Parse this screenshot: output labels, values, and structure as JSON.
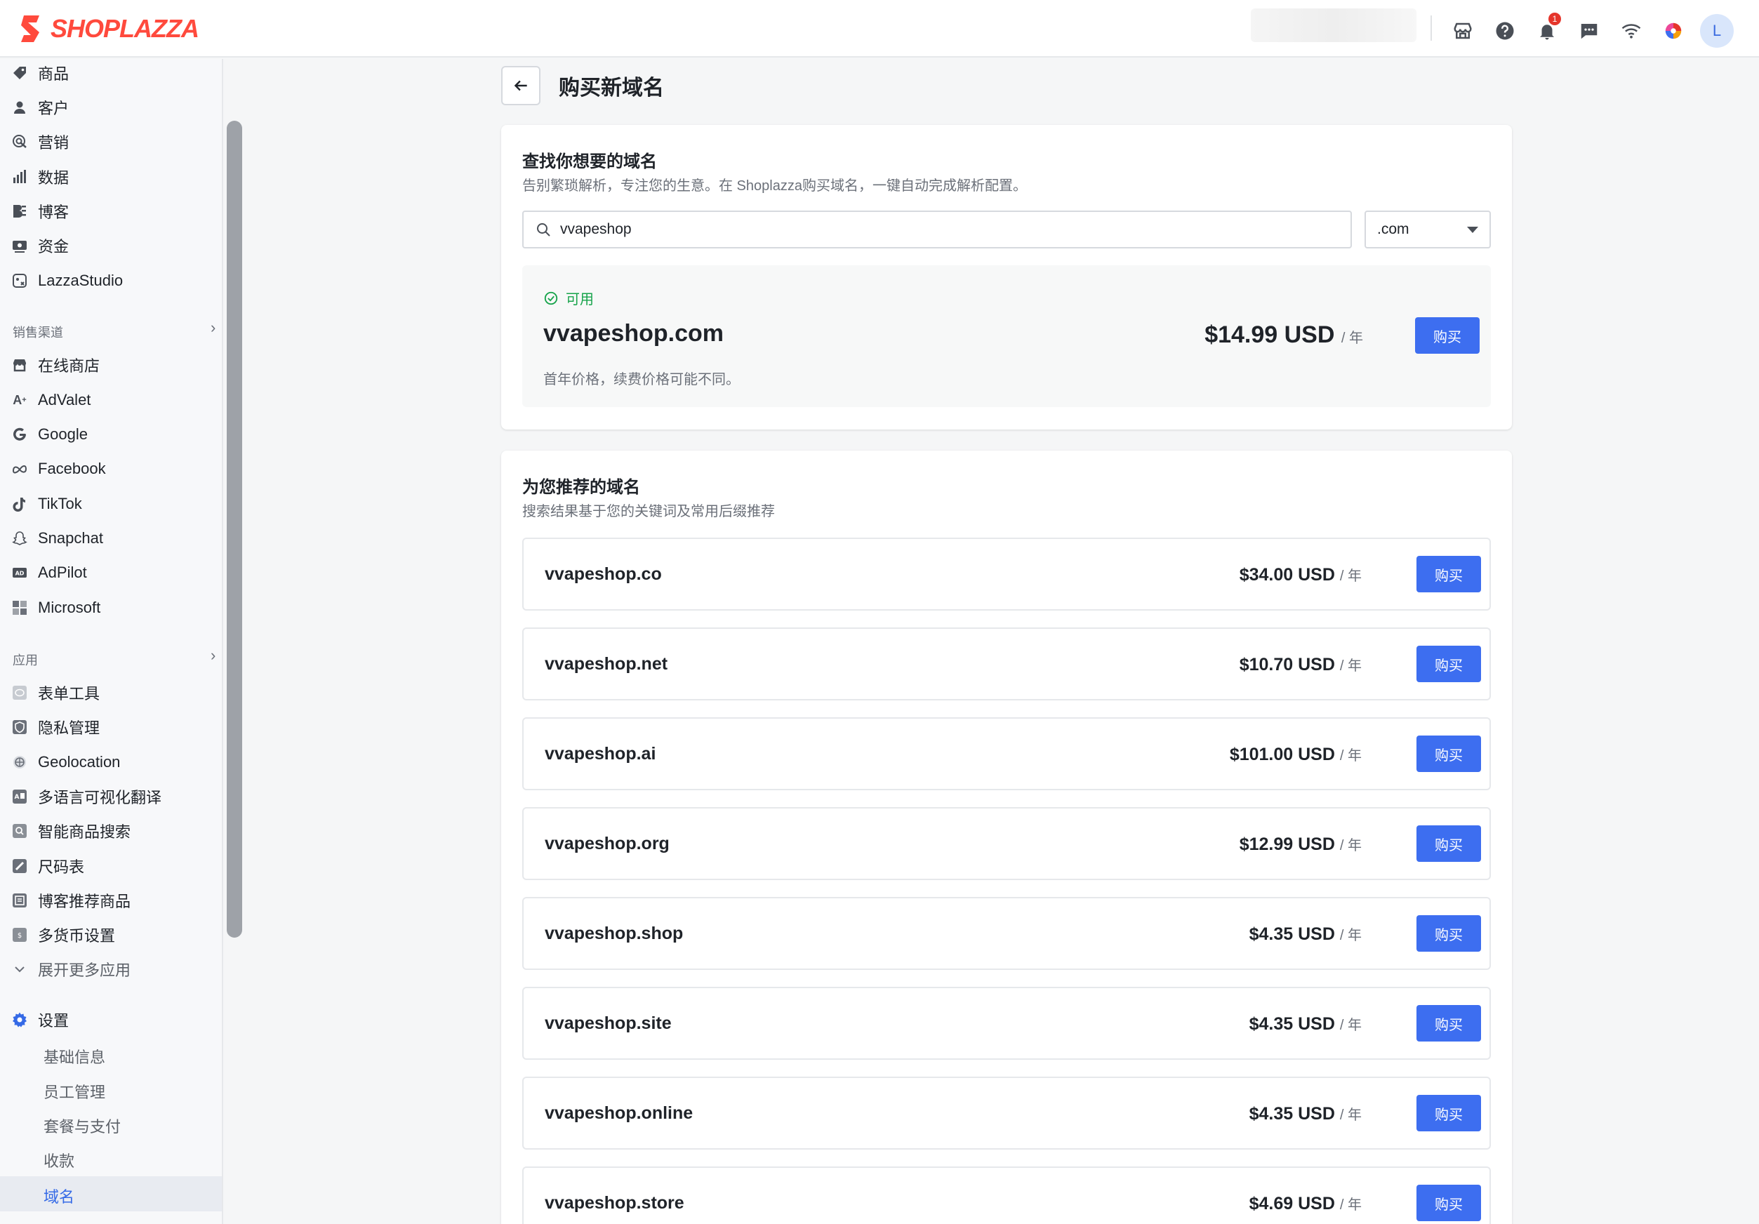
{
  "brand": {
    "name": "SHOPLAZZA",
    "color": "#ff4a3d"
  },
  "topbar": {
    "icons": [
      "store-icon",
      "help-icon",
      "bell-icon",
      "chat-icon",
      "wifi-icon",
      "color-wheel-icon"
    ],
    "notification_count": "1",
    "avatar_initial": "L"
  },
  "sidebar": {
    "main_items": [
      {
        "label": "商品",
        "icon": "tag-icon"
      },
      {
        "label": "客户",
        "icon": "user-icon"
      },
      {
        "label": "营销",
        "icon": "marketing-icon"
      },
      {
        "label": "数据",
        "icon": "chart-icon"
      },
      {
        "label": "博客",
        "icon": "blog-icon"
      },
      {
        "label": "资金",
        "icon": "money-icon"
      },
      {
        "label": "LazzaStudio",
        "icon": "studio-icon"
      }
    ],
    "sales_section": "销售渠道",
    "sales_items": [
      {
        "label": "在线商店",
        "icon": "store-icon"
      },
      {
        "label": "AdValet",
        "icon": "advalet-icon"
      },
      {
        "label": "Google",
        "icon": "google-icon"
      },
      {
        "label": "Facebook",
        "icon": "meta-icon"
      },
      {
        "label": "TikTok",
        "icon": "tiktok-icon"
      },
      {
        "label": "Snapchat",
        "icon": "snapchat-icon"
      },
      {
        "label": "AdPilot",
        "icon": "ad-icon"
      },
      {
        "label": "Microsoft",
        "icon": "microsoft-icon"
      }
    ],
    "apps_section": "应用",
    "app_items": [
      {
        "label": "表单工具",
        "icon": "form-icon"
      },
      {
        "label": "隐私管理",
        "icon": "shield-icon"
      },
      {
        "label": "Geolocation",
        "icon": "globe-icon"
      },
      {
        "label": "多语言可视化翻译",
        "icon": "translate-icon"
      },
      {
        "label": "智能商品搜索",
        "icon": "search-app-icon"
      },
      {
        "label": "尺码表",
        "icon": "ruler-icon"
      },
      {
        "label": "博客推荐商品",
        "icon": "blog-product-icon"
      },
      {
        "label": "多货币设置",
        "icon": "currency-icon"
      }
    ],
    "expand_label": "展开更多应用",
    "settings_label": "设置",
    "settings_items": [
      "基础信息",
      "员工管理",
      "套餐与支付",
      "收款",
      "域名"
    ],
    "active_item": "域名",
    "accent_color": "#356ae6"
  },
  "page": {
    "title": "购买新域名"
  },
  "search_card": {
    "title": "查找你想要的域名",
    "subtitle": "告别繁琐解析，专注您的生意。在 Shoplazza购买域名，一键自动完成解析配置。",
    "search_value": "vvapeshop",
    "tld_selected": ".com",
    "result": {
      "status": "可用",
      "domain": "vvapeshop.com",
      "price": "$14.99 USD",
      "per_year": "/ 年",
      "note": "首年价格，续费价格可能不同。",
      "buy_label": "购买"
    }
  },
  "recommend_card": {
    "title": "为您推荐的域名",
    "subtitle": "搜索结果基于您的关键词及常用后缀推荐",
    "per_year": "/ 年",
    "buy_label": "购买",
    "domains": [
      {
        "name": "vvapeshop.co",
        "price": "$34.00 USD"
      },
      {
        "name": "vvapeshop.net",
        "price": "$10.70 USD"
      },
      {
        "name": "vvapeshop.ai",
        "price": "$101.00 USD"
      },
      {
        "name": "vvapeshop.org",
        "price": "$12.99 USD"
      },
      {
        "name": "vvapeshop.shop",
        "price": "$4.35 USD"
      },
      {
        "name": "vvapeshop.site",
        "price": "$4.35 USD"
      },
      {
        "name": "vvapeshop.online",
        "price": "$4.35 USD"
      },
      {
        "name": "vvapeshop.store",
        "price": "$4.69 USD"
      }
    ]
  },
  "colors": {
    "primary_button": "#3d6ef0",
    "available": "#16a34a"
  }
}
